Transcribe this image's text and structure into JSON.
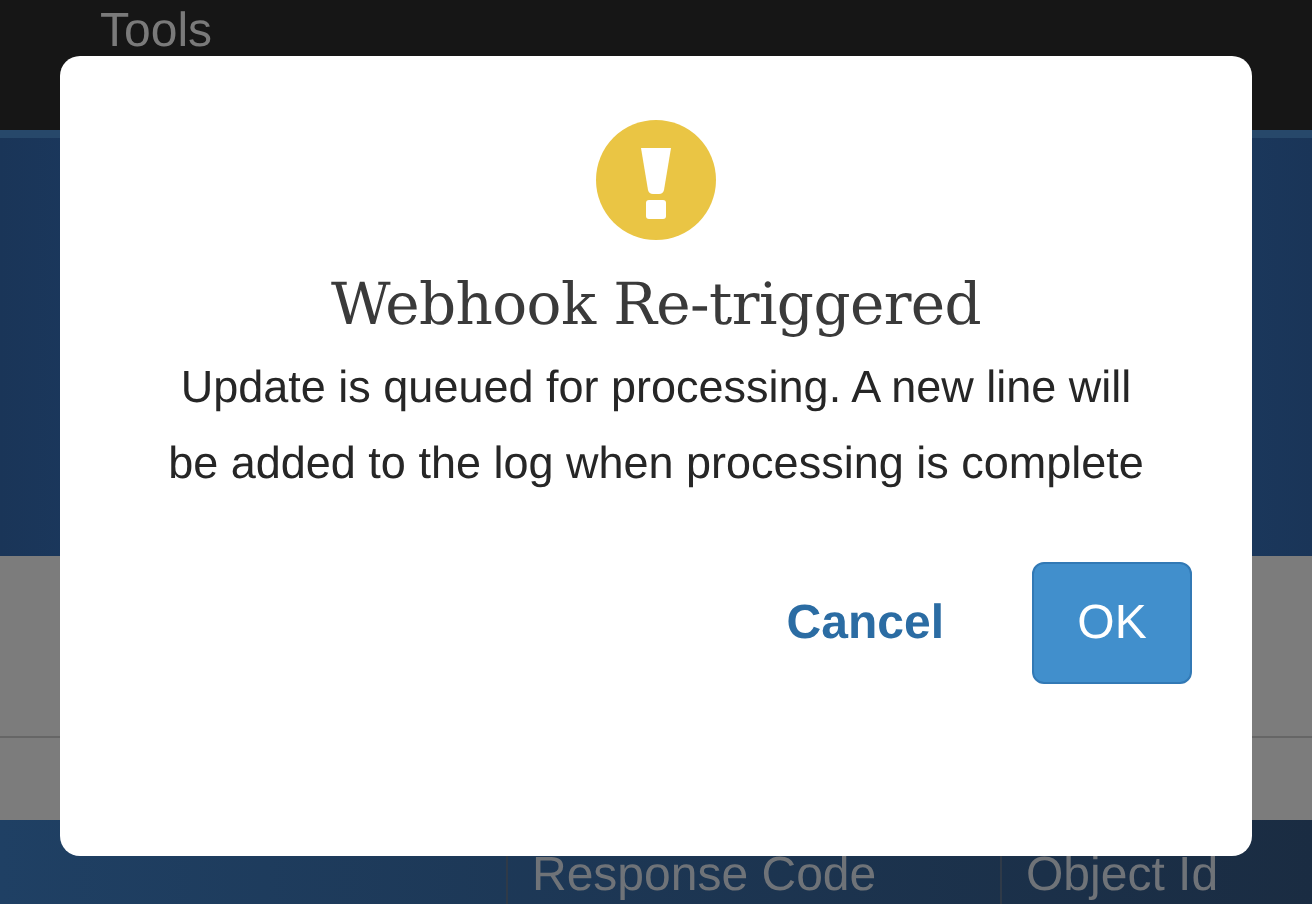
{
  "menu_bar": {
    "items": [
      "Tools"
    ]
  },
  "table": {
    "columns": [
      "Response Code",
      "Object Id"
    ]
  },
  "dialog": {
    "kind": "warning",
    "title": "Webhook Re-triggered",
    "message": "Update is queued for processing. A new line will be added to the log when processing is complete",
    "buttons": [
      {
        "label": "Cancel",
        "kind": "text"
      },
      {
        "label": "OK",
        "kind": "primary"
      }
    ]
  }
}
